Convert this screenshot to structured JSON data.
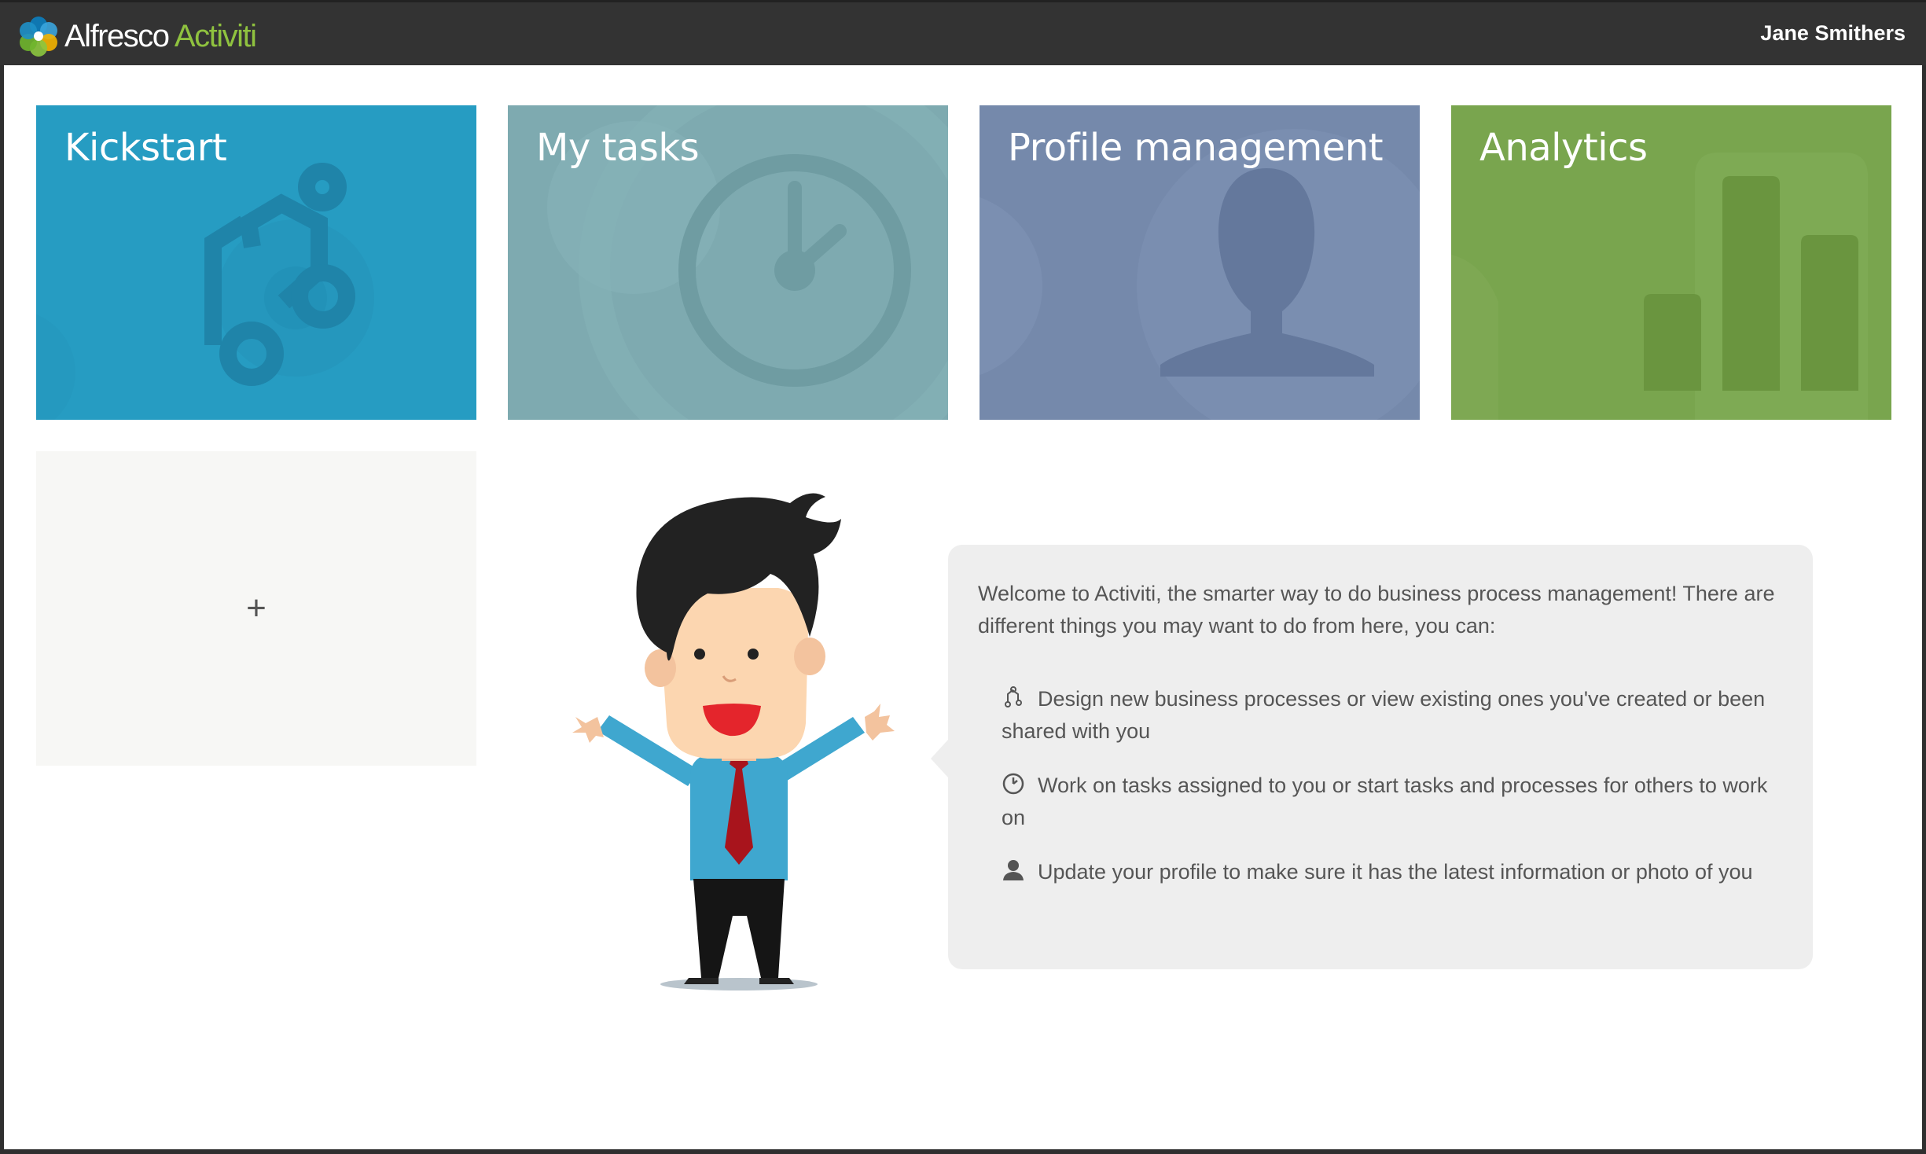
{
  "header": {
    "brand_name": "Alfresco",
    "brand_product": "Activiti",
    "user_name": "Jane Smithers"
  },
  "tiles": [
    {
      "title": "Kickstart",
      "icon": "process-diagram-icon",
      "color": "#269cc2"
    },
    {
      "title": "My tasks",
      "icon": "clock-icon",
      "color": "#7eaab0"
    },
    {
      "title": "Profile management",
      "icon": "user-silhouette-icon",
      "color": "#7589ab"
    },
    {
      "title": "Analytics",
      "icon": "bar-chart-icon",
      "color": "#79a54e"
    }
  ],
  "add_tile": {
    "label": "+"
  },
  "welcome": {
    "intro": "Welcome to Activiti, the smarter way to do business process management! There are different things you may want to do from here, you can:",
    "items": [
      {
        "icon": "process-icon",
        "text": "Design new business processes or view existing ones you've created or been shared with you"
      },
      {
        "icon": "clock-icon",
        "text": "Work on tasks assigned to you or start tasks and processes for others to work on"
      },
      {
        "icon": "user-icon",
        "text": "Update your profile to make sure it has the latest information or photo of you"
      }
    ]
  }
}
